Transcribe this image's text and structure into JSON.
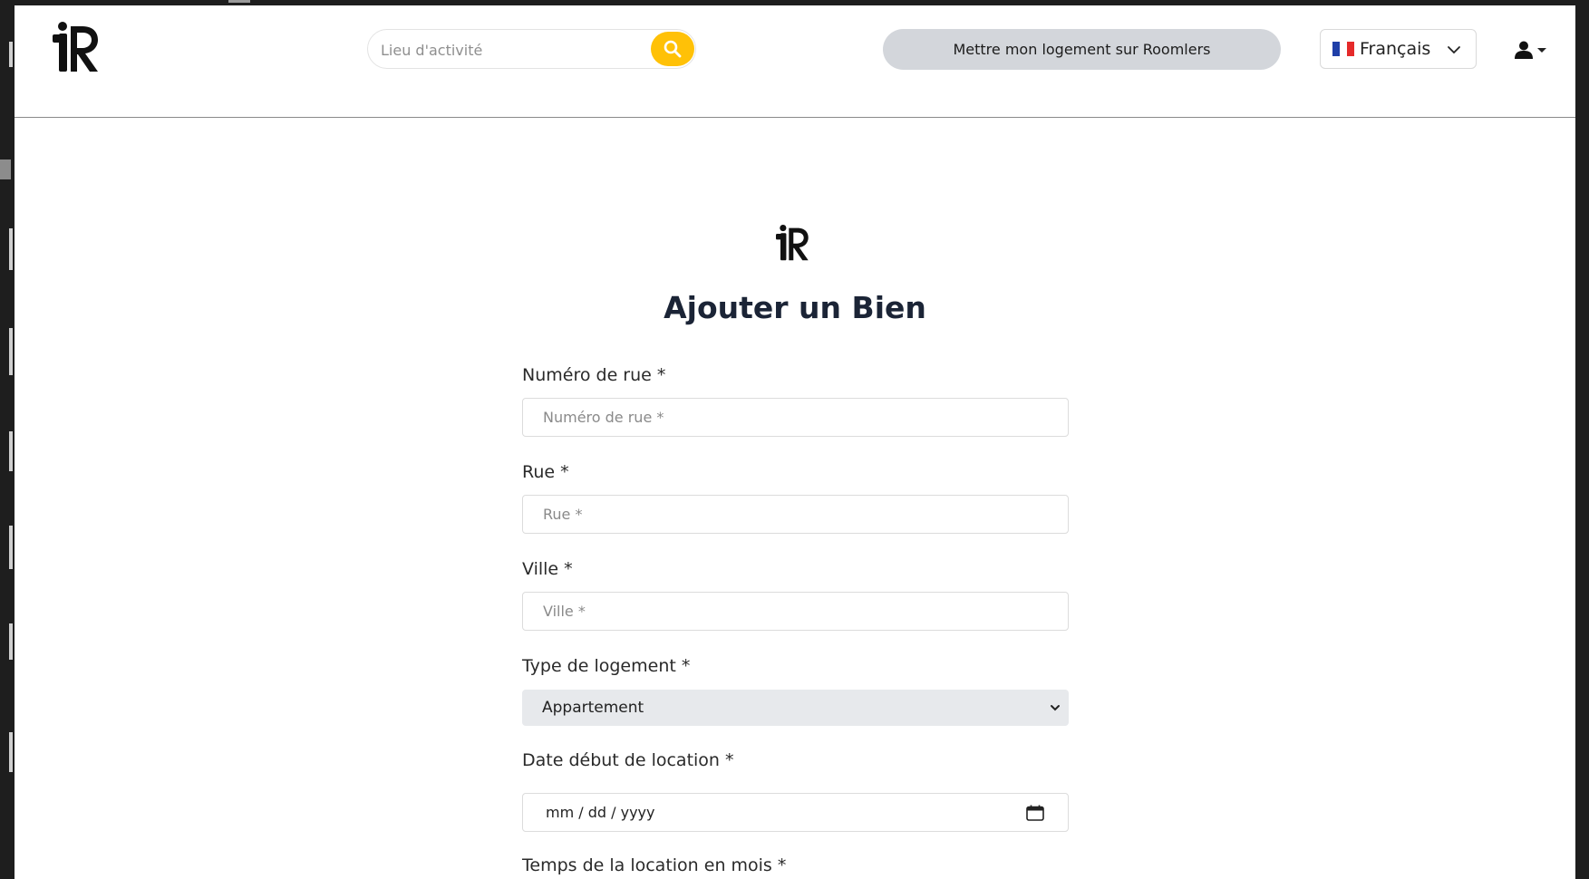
{
  "header": {
    "search": {
      "placeholder": "Lieu d'activité"
    },
    "host_button_label": "Mettre mon logement sur Roomlers",
    "language": {
      "selected": "Français"
    }
  },
  "form": {
    "title": "Ajouter un Bien",
    "fields": [
      {
        "label": "Numéro de rue *",
        "placeholder": "Numéro de rue *"
      },
      {
        "label": "Rue *",
        "placeholder": "Rue *"
      },
      {
        "label": "Ville *",
        "placeholder": "Ville *"
      }
    ],
    "housing_type": {
      "label": "Type de logement *",
      "selected": "Appartement"
    },
    "start_date": {
      "label": "Date début de location *",
      "placeholder": "mm / dd / yyyy"
    },
    "duration": {
      "label": "Temps de la location en mois *"
    }
  },
  "icons": {
    "logo": "roomlers-logo",
    "search": "search-icon",
    "language_chevron": "chevron-down-icon",
    "flag": "flag-fr-icon",
    "user": "user-icon",
    "select_chevron": "chevron-down-icon",
    "calendar": "calendar-icon"
  },
  "colors": {
    "accent": "#ffc107",
    "host_button_bg": "#d3d6db",
    "title_text": "#1b2436",
    "select_bg": "#e7e9ec"
  }
}
